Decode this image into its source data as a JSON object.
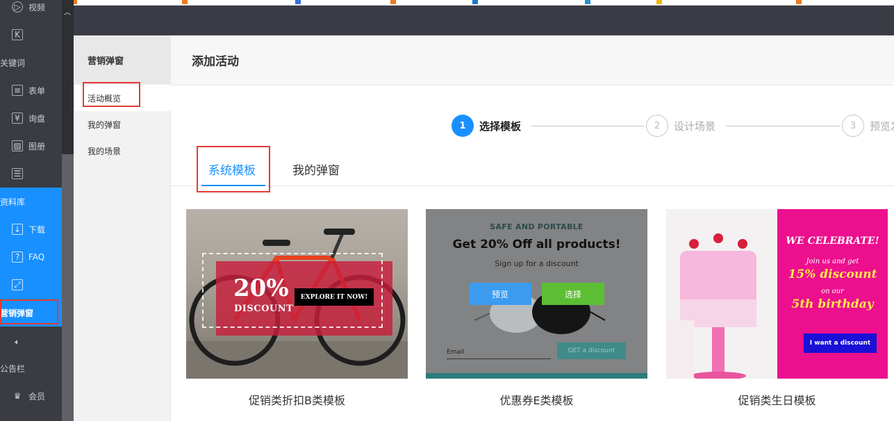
{
  "sidebar": {
    "items": [
      {
        "label": "视频",
        "icon": "play-circle-icon"
      },
      {
        "label": "",
        "icon": "k-box-icon"
      },
      {
        "label": "关键词",
        "icon": ""
      },
      {
        "label": "表单",
        "icon": "form-icon"
      },
      {
        "label": "询盘",
        "icon": "inquiry-icon"
      },
      {
        "label": "图册",
        "icon": "album-icon"
      },
      {
        "label": "",
        "icon": "stack-icon"
      },
      {
        "label": "资料库",
        "icon": ""
      },
      {
        "label": "下载",
        "icon": "download-icon"
      },
      {
        "label": "FAQ",
        "icon": "faq-icon"
      },
      {
        "label": "",
        "icon": "expand-icon"
      },
      {
        "label": "营销弹窗",
        "icon": ""
      },
      {
        "label": "",
        "icon": "speaker-icon"
      },
      {
        "label": "公告栏",
        "icon": ""
      },
      {
        "label": "会员",
        "icon": "crown-icon"
      }
    ],
    "active_color": "#1890ff"
  },
  "submenu": {
    "title": "营销弹窗",
    "items": [
      "活动概览",
      "我的弹窗",
      "我的场景"
    ]
  },
  "main": {
    "page_title": "添加活动",
    "steps": [
      {
        "num": "1",
        "label": "选择模板"
      },
      {
        "num": "2",
        "label": "设计场景"
      },
      {
        "num": "3",
        "label": "预览发"
      }
    ],
    "tabs": [
      "系统模板",
      "我的弹窗"
    ],
    "cards": [
      {
        "label": "促销类折扣B类模板",
        "pct": "20%",
        "discount": "DISCOUNT",
        "cta": "EXPLORE IT NOW!"
      },
      {
        "label": "优惠券E类模板",
        "safe": "SAFE AND PORTABLE",
        "title": "Get 20% Off all products!",
        "sub": "Sign up for a discount",
        "preview": "预览",
        "select": "选择",
        "email": "Email",
        "cta": "GET a discount"
      },
      {
        "label": "促销类生日模板",
        "celebrate": "WE CELEBRATE!",
        "joinus": "Join us and get",
        "discount": "15% discount",
        "onour": "on our",
        "bday": "5th birthday",
        "cta": "I want a discount"
      }
    ]
  },
  "colors": {
    "primary": "#1890ff",
    "highlight": "#e53935",
    "sidebar_bg": "#3a3c41",
    "select_green": "#5cbf33",
    "pink": "#ec0f8e"
  }
}
